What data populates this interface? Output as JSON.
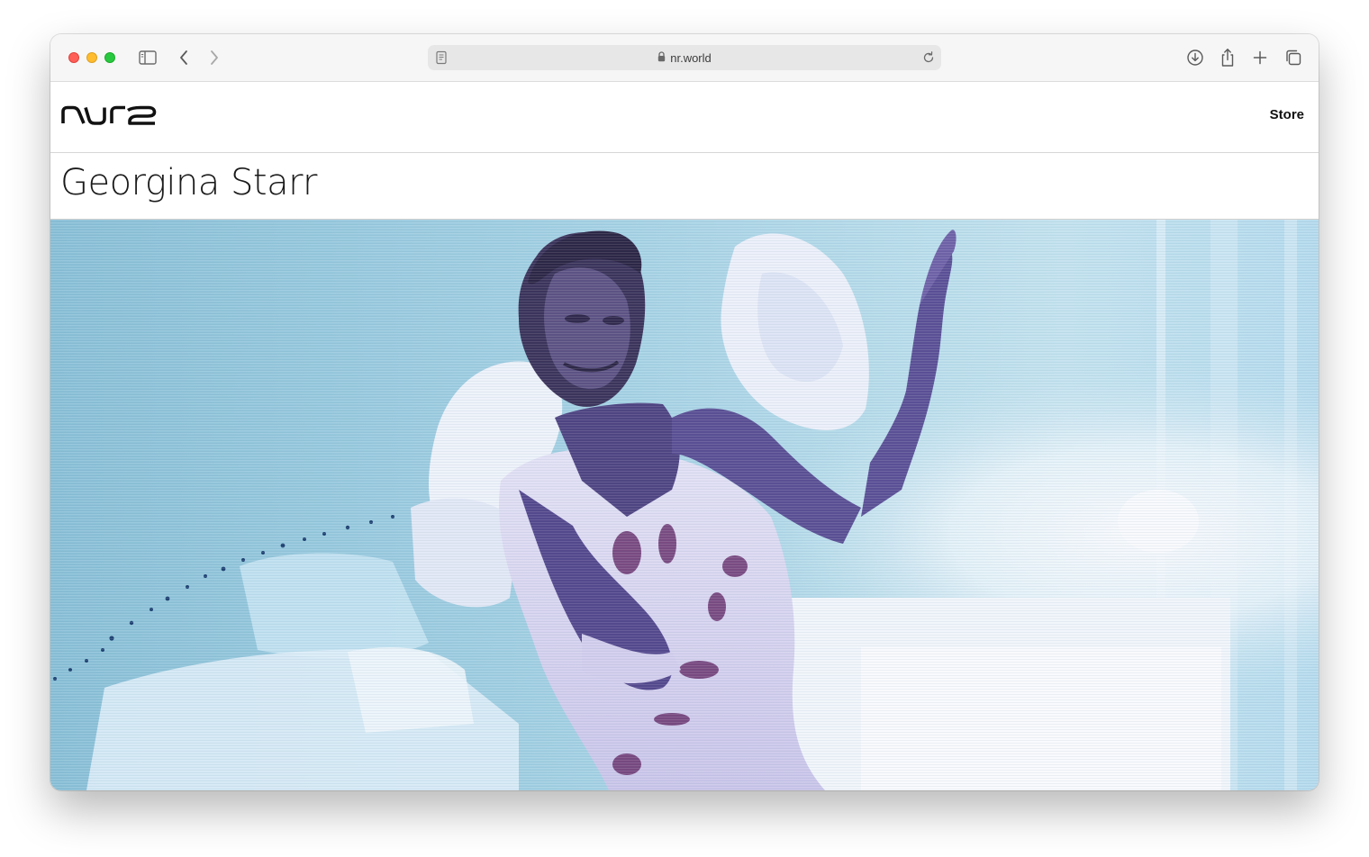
{
  "browser": {
    "url": "nr.world",
    "icons": [
      "sidebar-icon",
      "back-icon",
      "forward-icon",
      "page-icon",
      "lock-icon",
      "reload-icon",
      "download-icon",
      "share-icon",
      "new-tab-icon",
      "tab-overview-icon"
    ]
  },
  "header": {
    "logo_text": "NR",
    "nav": {
      "store_label": "Store"
    }
  },
  "main": {
    "title": "Georgina Starr",
    "hero": {
      "description": "artist-video-still"
    }
  },
  "colors": {
    "hero_bg": "#a7d3e3",
    "hero_figure": "#5a4b92",
    "traffic_close": "#ff5f57",
    "traffic_min": "#febc2e",
    "traffic_max": "#28c840"
  }
}
